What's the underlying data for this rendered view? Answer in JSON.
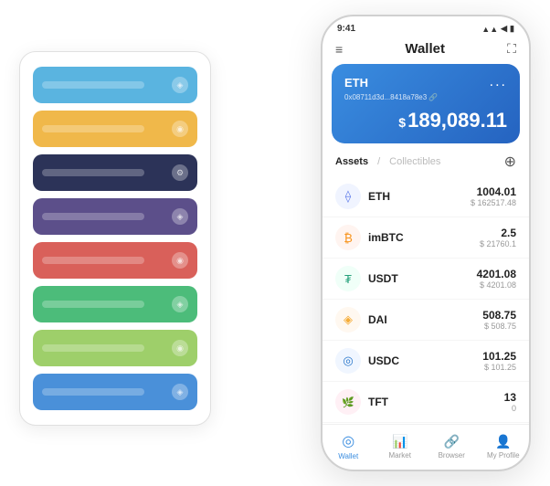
{
  "scene": {
    "cardStack": {
      "items": [
        {
          "color": "ci-1",
          "icon": "◈"
        },
        {
          "color": "ci-2",
          "icon": "◉"
        },
        {
          "color": "ci-3",
          "icon": "⚙"
        },
        {
          "color": "ci-4",
          "icon": "◈"
        },
        {
          "color": "ci-5",
          "icon": "◉"
        },
        {
          "color": "ci-6",
          "icon": "◈"
        },
        {
          "color": "ci-7",
          "icon": "◉"
        },
        {
          "color": "ci-8",
          "icon": "◈"
        }
      ]
    },
    "phone": {
      "statusBar": {
        "time": "9:41",
        "icons": "▲▲ ◀"
      },
      "header": {
        "menuIcon": "≡",
        "title": "Wallet",
        "expandIcon": "⛶"
      },
      "ethCard": {
        "label": "ETH",
        "dotsLabel": "...",
        "address": "0x08711d3d...8418a78e3",
        "addressSuffix": "🔗",
        "amountSymbol": "$",
        "amount": "189,089.11"
      },
      "assetsSection": {
        "tabActive": "Assets",
        "separator": "/",
        "tabInactive": "Collectibles",
        "addIcon": "⊕"
      },
      "assets": [
        {
          "id": "eth",
          "iconClass": "eth-icon",
          "iconText": "⟠",
          "name": "ETH",
          "amount": "1004.01",
          "usd": "$ 162517.48"
        },
        {
          "id": "imbtc",
          "iconClass": "imbtc-icon",
          "iconText": "₿",
          "name": "imBTC",
          "amount": "2.5",
          "usd": "$ 21760.1"
        },
        {
          "id": "usdt",
          "iconClass": "usdt-icon",
          "iconText": "₮",
          "name": "USDT",
          "amount": "4201.08",
          "usd": "$ 4201.08"
        },
        {
          "id": "dai",
          "iconClass": "dai-icon",
          "iconText": "◈",
          "name": "DAI",
          "amount": "508.75",
          "usd": "$ 508.75"
        },
        {
          "id": "usdc",
          "iconClass": "usdc-icon",
          "iconText": "◎",
          "name": "USDC",
          "amount": "101.25",
          "usd": "$ 101.25"
        },
        {
          "id": "tft",
          "iconClass": "tft-icon",
          "iconText": "🌿",
          "name": "TFT",
          "amount": "13",
          "usd": "0"
        }
      ],
      "bottomNav": [
        {
          "id": "wallet",
          "icon": "◎",
          "label": "Wallet",
          "active": true
        },
        {
          "id": "market",
          "icon": "📈",
          "label": "Market",
          "active": false
        },
        {
          "id": "browser",
          "icon": "🔗",
          "label": "Browser",
          "active": false
        },
        {
          "id": "profile",
          "icon": "👤",
          "label": "My Profile",
          "active": false
        }
      ]
    }
  }
}
